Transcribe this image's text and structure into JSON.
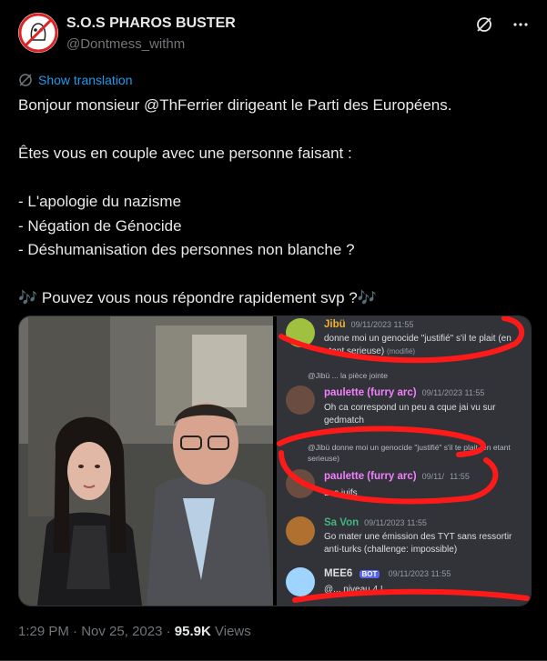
{
  "author": {
    "name": "S.O.S PHAROS BUSTER",
    "handle": "@Dontmess_withm"
  },
  "actions": {
    "translate_label": "Show translation"
  },
  "tweet": {
    "text": "Bonjour monsieur @ThFerrier dirigeant le Parti des Européens.\n\nÊtes vous en couple avec une personne faisant :\n\n- L'apologie du nazisme\n- Négation de Génocide\n- Déshumanisation des personnes non blanche ?\n\n🎶 Pouvez vous nous répondre rapidement svp ?🎶"
  },
  "media": {
    "discord": {
      "messages": [
        {
          "user": "Jibü",
          "time": "09/11/2023 11:55",
          "text": "donne moi un genocide \"justifié\" s'il te plait (en etant serieuse)",
          "mod": "(modifié)",
          "color": "#f0b132"
        },
        {
          "reply": "@Jibü ... la pièce jointe",
          "user": "paulette (furry arc)",
          "time": "09/11/2023 11:55",
          "text": "Oh ca correspond un peu a cque jai vu sur gedmatch",
          "color": "#f47fff"
        },
        {
          "reply": "@Jibü donne moi un genocide \"justifié\" s'il te plait (en etant serieuse)",
          "user": "paulette (furry arc)",
          "time": "09/11/",
          "time2": "11:55",
          "text": "Les juifs",
          "color": "#f47fff"
        },
        {
          "user": "Sa Von",
          "time": "09/11/2023 11:55",
          "text": "Go mater une émission des TYT sans ressortir anti-turks (challenge: impossible)",
          "color": "#43b581"
        },
        {
          "user": "MEE6",
          "badge": "BOT",
          "time": "09/11/2023 11:55",
          "text": "@... niveau 4 !",
          "color": "#dbdee1"
        }
      ]
    }
  },
  "footer": {
    "time": "1:29 PM",
    "separator": "·",
    "date": "Nov 25, 2023",
    "views_count": "95.9K",
    "views_label": "Views"
  },
  "colors": {
    "accent": "#1d9bf0",
    "scribble": "#ff1a1a"
  }
}
